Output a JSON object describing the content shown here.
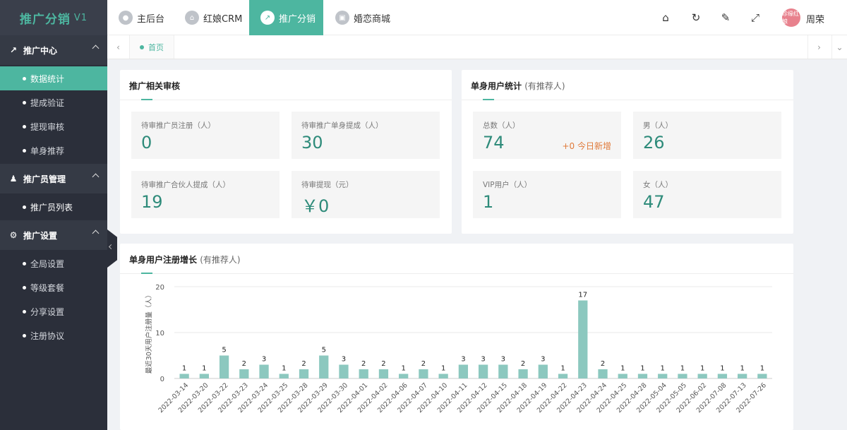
{
  "brand": {
    "name": "推广分销",
    "version": "V1"
  },
  "sidebar": {
    "groups": [
      {
        "label": "推广中心",
        "icon": "share-icon",
        "items": [
          {
            "label": "数据统计",
            "active": true
          },
          {
            "label": "提成验证"
          },
          {
            "label": "提现审核"
          },
          {
            "label": "单身推荐"
          }
        ]
      },
      {
        "label": "推广员管理",
        "icon": "user-manage-icon",
        "items": [
          {
            "label": "推广员列表"
          }
        ]
      },
      {
        "label": "推广设置",
        "icon": "gear-icon",
        "items": [
          {
            "label": "全局设置"
          },
          {
            "label": "等级套餐"
          },
          {
            "label": "分享设置"
          },
          {
            "label": "注册协议"
          }
        ]
      }
    ]
  },
  "topbar": {
    "tabs": [
      {
        "label": "主后台",
        "icon": "user-circle-icon"
      },
      {
        "label": "红娘CRM",
        "icon": "home-circle-icon"
      },
      {
        "label": "推广分销",
        "icon": "share-circle-icon",
        "active": true
      },
      {
        "label": "婚恋商城",
        "icon": "store-circle-icon"
      }
    ],
    "user": {
      "name": "周荣",
      "avatar_text": "珍缘红娘"
    }
  },
  "tabbar": {
    "home_label": "首页"
  },
  "review_card": {
    "title": "推广相关审核",
    "stats": [
      {
        "label": "待审推广员注册（人）",
        "value": "0"
      },
      {
        "label": "待审推广单身提成（人）",
        "value": "30"
      },
      {
        "label": "待审推广合伙人提成（人）",
        "value": "19"
      },
      {
        "label": "待审提现（元）",
        "value": "￥0"
      }
    ]
  },
  "user_stats_card": {
    "title": "单身用户统计",
    "subtitle": "(有推荐人)",
    "stats": [
      {
        "label": "总数（人）",
        "value": "74",
        "extra": "+0 今日新增"
      },
      {
        "label": "男（人）",
        "value": "26"
      },
      {
        "label": "VIP用户（人）",
        "value": "1"
      },
      {
        "label": "女（人）",
        "value": "47"
      }
    ]
  },
  "chart_card": {
    "title": "单身用户注册增长",
    "subtitle": "(有推荐人)"
  },
  "chart_data": {
    "type": "bar",
    "ylabel": "最近30天用户注册量（人）",
    "ylim": [
      0,
      20
    ],
    "yticks": [
      0,
      10,
      20
    ],
    "grid": true,
    "color": "#8cc8bf",
    "categories": [
      "2022-03-14",
      "2022-03-20",
      "2022-03-22",
      "2022-03-23",
      "2022-03-24",
      "2022-03-25",
      "2022-03-28",
      "2022-03-29",
      "2022-03-30",
      "2022-04-01",
      "2022-04-02",
      "2022-04-06",
      "2022-04-07",
      "2022-04-10",
      "2022-04-11",
      "2022-04-12",
      "2022-04-15",
      "2022-04-18",
      "2022-04-19",
      "2022-04-22",
      "2022-04-23",
      "2022-04-24",
      "2022-04-25",
      "2022-04-28",
      "2022-05-04",
      "2022-05-05",
      "2022-06-02",
      "2022-07-08",
      "2022-07-13",
      "2022-07-26"
    ],
    "values": [
      1,
      1,
      5,
      2,
      3,
      1,
      2,
      5,
      3,
      2,
      2,
      1,
      2,
      1,
      3,
      3,
      3,
      2,
      3,
      1,
      17,
      2,
      1,
      1,
      1,
      1,
      1,
      1,
      1,
      1
    ]
  },
  "colors": {
    "accent": "#4db6a0",
    "sidebar_bg": "#2b2f3a",
    "value_text": "#2e8b7a",
    "highlight": "#e07a3a"
  }
}
